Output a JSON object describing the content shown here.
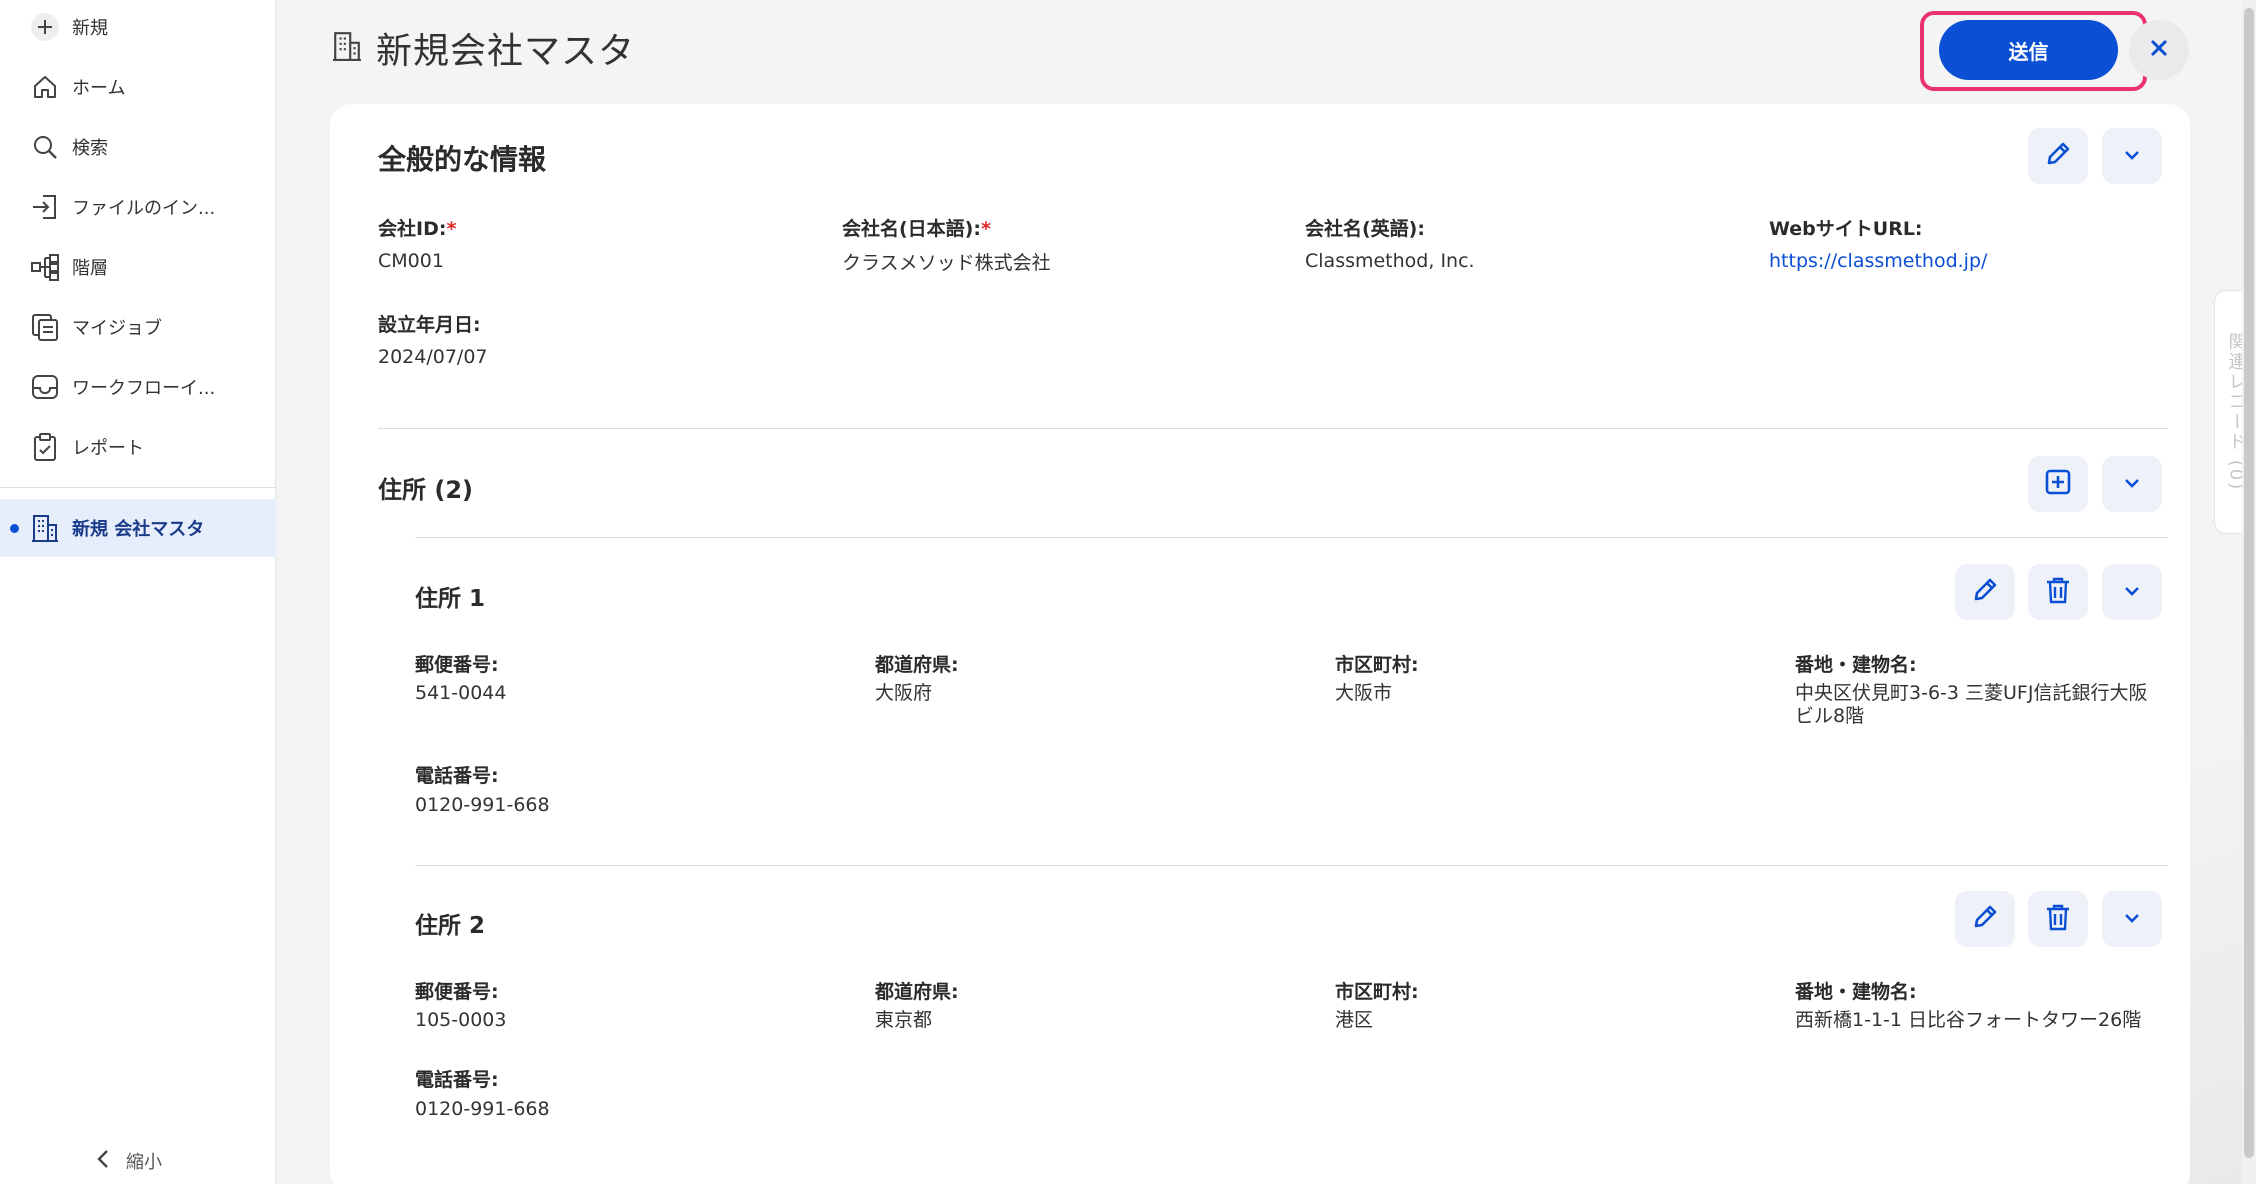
{
  "sidebar": {
    "items": [
      {
        "label": "新規",
        "icon": "plus-icon"
      },
      {
        "label": "ホーム",
        "icon": "home-icon"
      },
      {
        "label": "検索",
        "icon": "search-icon"
      },
      {
        "label": "ファイルのイン...",
        "icon": "import-icon"
      },
      {
        "label": "階層",
        "icon": "hierarchy-icon"
      },
      {
        "label": "マイジョブ",
        "icon": "jobs-icon"
      },
      {
        "label": "ワークフローイ...",
        "icon": "inbox-icon"
      },
      {
        "label": "レポート",
        "icon": "report-icon"
      }
    ],
    "active_item": {
      "label": "新規 会社マスタ",
      "icon": "building-icon"
    },
    "collapse_label": "縮小"
  },
  "header": {
    "title": "新規会社マスタ",
    "title_icon": "building-icon",
    "submit_label": "送信",
    "close_icon": "close-icon"
  },
  "general": {
    "title": "全般的な情報",
    "fields": [
      {
        "label": "会社ID:",
        "required": "*",
        "value": "CM001"
      },
      {
        "label": "会社名(日本語):",
        "required": "*",
        "value": "クラスメソッド株式会社"
      },
      {
        "label": "会社名(英語):",
        "required": "",
        "value": "Classmethod, Inc."
      },
      {
        "label": "WebサイトURL:",
        "required": "",
        "value": "https://classmethod.jp/"
      },
      {
        "label": "設立年月日:",
        "required": "",
        "value": "2024/07/07"
      }
    ]
  },
  "addresses": {
    "title": "住所 (2)",
    "items": [
      {
        "title": "住所 1",
        "postal_label": "郵便番号:",
        "postal": "541-0044",
        "prefecture_label": "都道府県:",
        "prefecture": "大阪府",
        "city_label": "市区町村:",
        "city": "大阪市",
        "street_label": "番地・建物名:",
        "street_line1": "中央区伏見町3-6-3 三菱UFJ信託銀行大阪",
        "street_line2": "ビル8階",
        "phone_label": "電話番号:",
        "phone": "0120-991-668"
      },
      {
        "title": "住所 2",
        "postal_label": "郵便番号:",
        "postal": "105-0003",
        "prefecture_label": "都道府県:",
        "prefecture": "東京都",
        "city_label": "市区町村:",
        "city": "港区",
        "street_label": "番地・建物名:",
        "street_line1": "西新橋1-1-1 日比谷フォートタワー26階",
        "street_line2": "",
        "phone_label": "電話番号:",
        "phone": "0120-991-668"
      }
    ]
  },
  "rail": {
    "label": "関連レコード (0)"
  },
  "colors": {
    "accent": "#0b4fd4",
    "highlight": "#e8336f",
    "required": "#e02424"
  }
}
